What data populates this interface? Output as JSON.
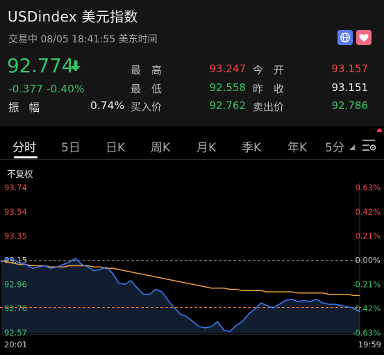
{
  "quote": {
    "title": "USDindex  美元指数",
    "status": "交易中 08/05 18:41:55 美东时间",
    "price": "92.774",
    "change": "-0.377 -0.40%",
    "amplitude_label": "振幅",
    "amplitude_value": "0.74%"
  },
  "stats": [
    {
      "label": "最　高",
      "value": "93.247",
      "color": "red"
    },
    {
      "label": "今　开",
      "value": "93.157",
      "color": "red"
    },
    {
      "label": "最　低",
      "value": "92.558",
      "color": "green"
    },
    {
      "label": "昨　收",
      "value": "93.151",
      "color": "white"
    },
    {
      "label": "买入价",
      "value": "92.762",
      "color": "green"
    },
    {
      "label": "卖出价",
      "value": "92.786",
      "color": "green"
    }
  ],
  "tabs": [
    "分时",
    "5日",
    "日K",
    "周K",
    "月K",
    "季K",
    "年K",
    "5分"
  ],
  "chart_label": "不复权",
  "icons": {
    "globe": "globe-icon",
    "heart": "heart-icon",
    "settings": "chart-settings-icon",
    "arrow": "arrow-down-icon"
  },
  "colors": {
    "up": "#f24a4a",
    "down": "#35c46a",
    "line": "#3d7af2",
    "avg": "#f0a23a",
    "bg": "#000000"
  },
  "chart_data": {
    "type": "line",
    "series": [
      {
        "values": [
          93.14,
          93.17,
          93.16,
          93.13,
          93.12,
          93.09,
          93.1,
          93.11,
          93.09,
          93.1,
          93.12,
          93.14,
          93.17,
          93.12,
          93.1,
          93.07,
          93.08,
          93.1,
          93.05,
          92.97,
          92.96,
          92.99,
          92.93,
          92.88,
          92.88,
          92.92,
          92.9,
          92.83,
          92.77,
          92.72,
          92.7,
          92.66,
          92.62,
          92.61,
          92.62,
          92.66,
          92.59,
          92.58,
          92.63,
          92.66,
          92.72,
          92.76,
          92.81,
          92.79,
          92.77,
          92.8,
          92.83,
          92.84,
          92.82,
          92.83,
          92.82,
          92.84,
          92.81,
          92.8,
          92.8,
          92.79,
          92.78,
          92.77,
          92.74
        ]
      },
      {
        "values": [
          93.15,
          93.14,
          93.13,
          93.12,
          93.12,
          93.11,
          93.11,
          93.11,
          93.1,
          93.1,
          93.1,
          93.11,
          93.11,
          93.11,
          93.11,
          93.1,
          93.1,
          93.09,
          93.09,
          93.08,
          93.07,
          93.06,
          93.05,
          93.04,
          93.03,
          93.02,
          93.01,
          93.0,
          92.99,
          92.98,
          92.97,
          92.96,
          92.95,
          92.94,
          92.93,
          92.93,
          92.93,
          92.92,
          92.92,
          92.91,
          92.91,
          92.91,
          92.91,
          92.9,
          92.9,
          92.9,
          92.9,
          92.9,
          92.89,
          92.89,
          92.89,
          92.89,
          92.89,
          92.88,
          92.88,
          92.88,
          92.88,
          92.87,
          92.87
        ]
      }
    ],
    "x_start": "20:01",
    "x_end": "19:59",
    "prev_close": 93.151,
    "current": 92.774,
    "y_ticks": [
      "93.74",
      "93.54",
      "93.35",
      "93.15",
      "92.96",
      "92.76",
      "92.57"
    ],
    "y_right_ticks": [
      "0.63%",
      "0.42%",
      "0.21%",
      "0.00%",
      "-0.21%",
      "-0.42%",
      "-0.63%"
    ],
    "ylim": [
      92.57,
      93.74
    ]
  }
}
